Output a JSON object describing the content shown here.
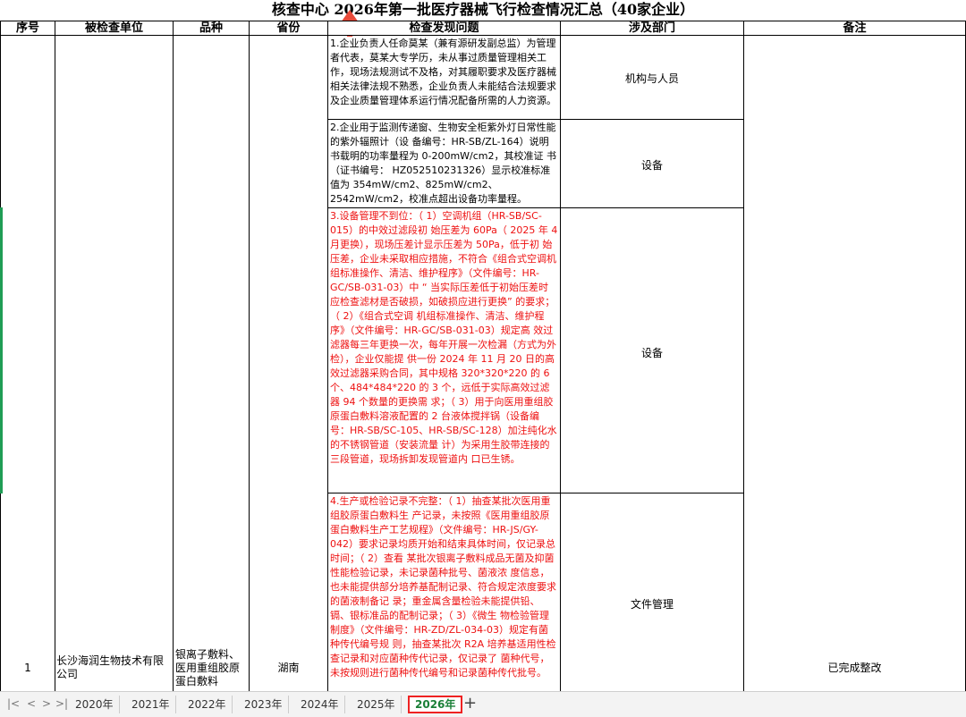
{
  "title": "核查中心 2026年第一批医疗器械飞行检查情况汇总（40家企业）",
  "headers": {
    "seq": "序号",
    "company": "被检查单位",
    "product": "品种",
    "province": "省份",
    "issues": "检查发现问题",
    "dept": "涉及部门",
    "remark": "备注"
  },
  "row": {
    "seq": "1",
    "company": "长沙海润生物技术有限公司",
    "product": "银离子敷料、医用重组胶原蛋白敷料",
    "province": "湖南",
    "remark": "已完成整改"
  },
  "issues": [
    {
      "text": "1.企业负责人任命莫某（兼有源研发副总监）为管理者代表，莫某大专学历，未从事过质量管理相关工作，现场法规测试不及格，对其履职要求及医疗器械相关法律法规不熟悉，企业负责人未能结合法规要求及企业质量管理体系运行情况配备所需的人力资源。",
      "dept": "机构与人员",
      "color": "#000000"
    },
    {
      "text": "2.企业用于监测传递窗、生物安全柜紫外灯日常性能的紫外辐照计（设 备编号：HR-SB/ZL-164）说明书载明的功率量程为 0-200mW/cm2，其校准证 书（证书编号： HZ052510231326）显示校准标准值为 354mW/cm2、825mW/cm2、2542mW/cm2，校准点超出设备功率量程。",
      "dept": "设备",
      "color": "#000000"
    },
    {
      "text": "3.设备管理不到位：（ 1）空调机组（HR-SB/SC-015）的中效过滤段初 始压差为 60Pa（ 2025 年 4 月更换），现场压差计显示压差为 50Pa，低于初 始压差，企业未采取相应措施，不符合《组合式空调机组标准操作、清洁、维护程序》（文件编号：HR-GC/SB-031-03）中 “ 当实际压差低于初始压差时应检查滤材是否破损，如破损应进行更换” 的要求；（ 2）《组合式空调 机组标准操作、清洁、维护程序》（文件编号：HR-GC/SB-031-03）规定高 效过滤器每三年更换一次，每年开展一次检漏（方式为外检），企业仅能提 供一份 2024 年 11 月 20 日的高效过滤器采购合同，其中规格 320*320*220 的 6 个、484*484*220 的 3 个，远低于实际高效过滤器 94 个数量的更换需 求；（ 3）用于向医用重组胶原蛋白敷料溶液配置的 2 台液体搅拌锅（设备编号：HR-SB/SC-105、HR-SB/SC-128）加注纯化水的不锈钢管道（安装流量 计）为采用生胶带连接的三段管道，现场拆卸发现管道内 口已生锈。",
      "dept": "设备",
      "color": "#ee1111"
    },
    {
      "text": "4.生产或检验记录不完整：（ 1）抽查某批次医用重组胶原蛋白敷料生 产记录，未按照《医用重组胶原蛋白敷料生产工艺规程》（文件编号：HR-JS/GY-042）要求记录均质开始和结束具体时间，仅记录总时间；（ 2）查看 某批次银离子敷料成品无菌及抑菌性能检验记录，未记录菌种批号、菌液浓 度信息，也未能提供部分培养基配制记录、符合规定浓度要求的菌液制备记 录；重金属含量检验未能提供铅、镉、银标准品的配制记录；（ 3）《微生 物检验管理制度》（文件编号：HR-ZD/ZL-034-03）规定有菌种传代编号规 则，抽查某批次 R2A 培养基适用性检查记录和对应菌种传代记录，仅记录了 菌种代号，未按规则进行菌种传代编号和记录菌种传代批号。",
      "dept": "文件管理",
      "color": "#ee1111"
    }
  ],
  "tabs": [
    "2020年",
    "2021年",
    "2022年",
    "2023年",
    "2024年",
    "2025年",
    "2026年"
  ],
  "active_tab": "2026年",
  "colors": {
    "issue_red": "#ee1111",
    "active_tab_text": "#1a7f37",
    "active_tab_border": "#ee2222"
  }
}
